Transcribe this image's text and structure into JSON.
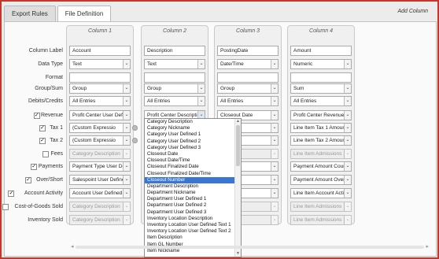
{
  "tabs": [
    {
      "label": "Export Rules",
      "active": false
    },
    {
      "label": "File Definition",
      "active": true
    }
  ],
  "add_column_label": "Add Column",
  "row_labels": [
    {
      "label": "Column Label",
      "checkbox": null
    },
    {
      "label": "Data Type",
      "checkbox": null
    },
    {
      "label": "Format",
      "checkbox": null
    },
    {
      "label": "Group/Sum",
      "checkbox": null
    },
    {
      "label": "Debits/Credits",
      "checkbox": null
    },
    {
      "label": "Revenue",
      "checkbox": true
    },
    {
      "label": "Tax 1",
      "checkbox": true
    },
    {
      "label": "Tax 2",
      "checkbox": true
    },
    {
      "label": "Fees",
      "checkbox": false
    },
    {
      "label": "Payments",
      "checkbox": true
    },
    {
      "label": "Over/Short",
      "checkbox": true
    },
    {
      "label": "Account Activity",
      "checkbox": true
    },
    {
      "label": "Cost-of-Goods Sold",
      "checkbox": false
    },
    {
      "label": "Inventory Sold",
      "checkbox": null
    }
  ],
  "columns": [
    {
      "heading": "Column 1",
      "fields": [
        "Account",
        "Text",
        "",
        "Group",
        "All Entries",
        "Profit Center User Defi",
        "(Custom Expressio",
        "(Custom Expressio",
        "Category Description",
        "Payment Type User De",
        "Salespoint User Define",
        "Account User Defined",
        "Category Description",
        "Category Description"
      ]
    },
    {
      "heading": "Column 2",
      "fields": [
        "Description",
        "Text",
        "",
        "Group",
        "All Entries",
        "Profit Center Descriptio",
        "",
        "",
        "",
        "",
        "",
        "",
        "",
        ""
      ]
    },
    {
      "heading": "Column 3",
      "fields": [
        "PostingDate",
        "Date/Time",
        "",
        "Group",
        "All Entries",
        "Closeout Date",
        "Date",
        "Date",
        "Date",
        "Date",
        "Date",
        "Date",
        "Date",
        "Date"
      ]
    },
    {
      "heading": "Column 4",
      "fields": [
        "Amount",
        "Numeric",
        "",
        "Sum",
        "All Entries",
        "Profit Center Revenue",
        "Line Item Tax 1 Amoun",
        "Line Item Tax 2 Amoun",
        "Line Item Admissions",
        "Payment Amount Cour",
        "Payment Amount Over",
        "Line Item Account Activ",
        "Line Item Admissions",
        "Line Item Admissions"
      ]
    }
  ],
  "dropdown_list": {
    "items": [
      "Category Description",
      "Category Nickname",
      "Category User Defined 1",
      "Category User Defined 2",
      "Category User Defined 3",
      "Closeout Date",
      "Closeout Date/Time",
      "Closeout Finalized Date",
      "Closeout Finalized Date/Time",
      "Closeout Number",
      "Department Description",
      "Department Nickname",
      "Department User Defined 1",
      "Department User Defined 2",
      "Department User Defined 3",
      "Inventory Location Description",
      "Inventory Location User Defined Text 1",
      "Inventory Location User Defined Text 2",
      "Item Description",
      "Item GL Number",
      "Item Nickname"
    ],
    "selected": "Closeout Number"
  }
}
